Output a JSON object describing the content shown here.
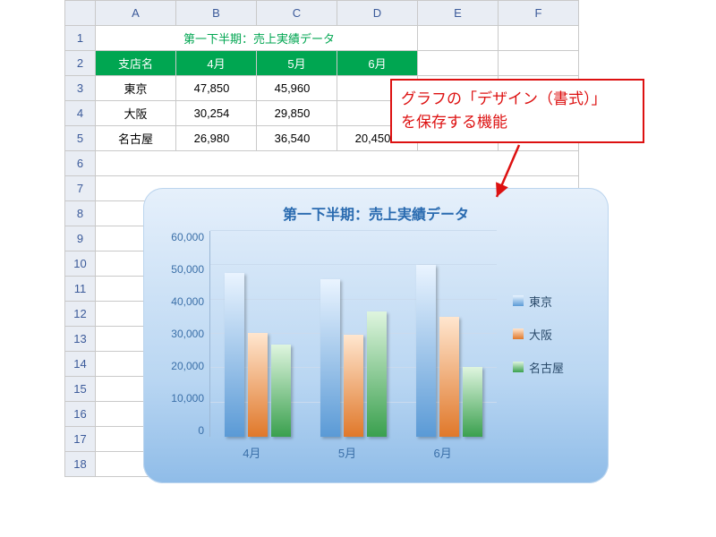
{
  "columns": [
    "A",
    "B",
    "C",
    "D",
    "E",
    "F"
  ],
  "rows": [
    "1",
    "2",
    "3",
    "4",
    "5",
    "6",
    "7",
    "8",
    "9",
    "10",
    "11",
    "12",
    "13",
    "14",
    "15",
    "16",
    "17",
    "18"
  ],
  "table": {
    "title": "第一下半期：売上実績データ",
    "headers": [
      "支店名",
      "4月",
      "5月",
      "6月"
    ],
    "data": [
      {
        "name": "東京",
        "vals": [
          "47,850",
          "45,960",
          ""
        ]
      },
      {
        "name": "大阪",
        "vals": [
          "30,254",
          "29,850",
          ""
        ]
      },
      {
        "name": "名古屋",
        "vals": [
          "26,980",
          "36,540",
          "20,450"
        ]
      }
    ]
  },
  "callout": {
    "line1": "グラフの「デザイン（書式）」",
    "line2": "を保存する機能"
  },
  "chart_data": {
    "type": "bar",
    "title": "第一下半期：売上実績データ",
    "categories": [
      "4月",
      "5月",
      "6月"
    ],
    "series": [
      {
        "name": "東京",
        "values": [
          47850,
          45960,
          50000
        ]
      },
      {
        "name": "大阪",
        "values": [
          30254,
          29850,
          35000
        ]
      },
      {
        "name": "名古屋",
        "values": [
          26980,
          36540,
          20450
        ]
      }
    ],
    "ylabel": "",
    "xlabel": "",
    "ylim": [
      0,
      60000
    ],
    "yticks": [
      "60,000",
      "50,000",
      "40,000",
      "30,000",
      "20,000",
      "10,000",
      "0"
    ]
  }
}
